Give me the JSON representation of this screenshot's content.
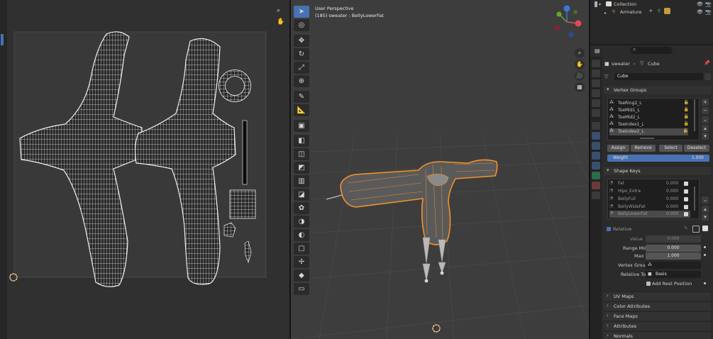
{
  "viewport": {
    "perspective_label": "User Perspective",
    "object_label": "(185) sweater : BellyLowerFat"
  },
  "outliner": {
    "collection_label": "Collection",
    "armature_label": "Armature"
  },
  "properties": {
    "breadcrumb_object": "sweater",
    "breadcrumb_data": "Cube",
    "mesh_name": "Cube",
    "vertex_groups": {
      "title": "Vertex Groups",
      "items": [
        "ToeRing2_L",
        "ToeMid1_L",
        "ToeMid2_L",
        "ToeIndex1_L",
        "ToeIndex2_L"
      ],
      "assign_label": "Assign",
      "remove_label": "Remove",
      "select_label": "Select",
      "deselect_label": "Deselect",
      "weight_label": "Weight",
      "weight_value": "1.000"
    },
    "shape_keys": {
      "title": "Shape Keys",
      "items": [
        {
          "name": "Fat",
          "value": "0.000"
        },
        {
          "name": "Hips_Extra",
          "value": "0.000"
        },
        {
          "name": "BellyFull",
          "value": "0.000"
        },
        {
          "name": "BellyWideFat",
          "value": "0.000"
        },
        {
          "name": "BellyLowerFat",
          "value": "0.000"
        }
      ],
      "relative_label": "Relative",
      "value_label": "Value",
      "value_value": "0.000",
      "range_min_label": "Range Min",
      "range_min_value": "0.000",
      "max_label": "Max",
      "max_value": "1.000",
      "vertex_group_label": "Vertex Group",
      "relative_to_label": "Relative To",
      "relative_to_value": "Basis",
      "add_rest_label": "Add Rest Position"
    },
    "collapsed_panels": [
      "UV Maps",
      "Color Attributes",
      "Face Maps",
      "Attributes",
      "Normals"
    ]
  },
  "colors": {
    "accent_blue": "#4772b3",
    "selection_orange": "#f5912a",
    "uv_background": "#303030",
    "viewport_background": "#3d3d3d"
  }
}
